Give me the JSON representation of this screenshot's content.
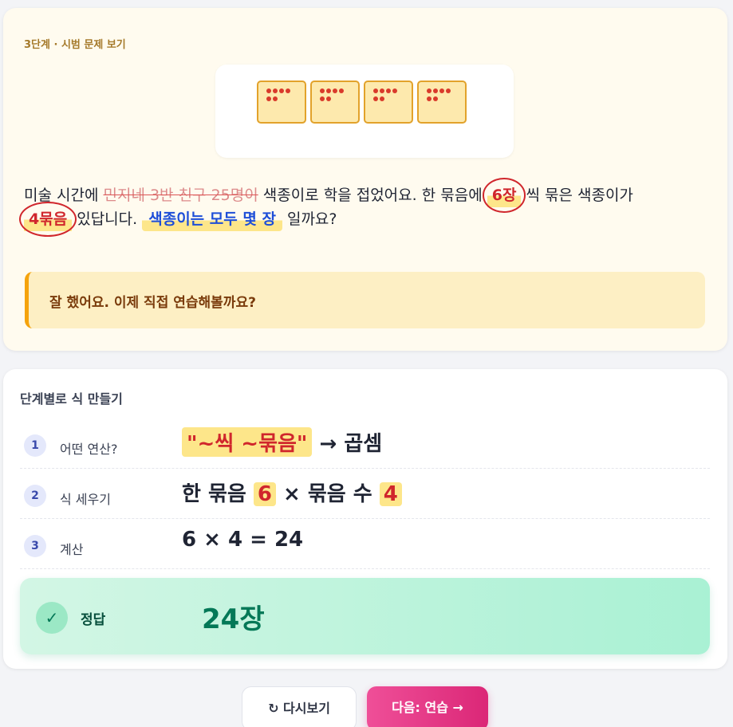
{
  "step_label": "3단계 · 시범 문제 보기",
  "illustration": {
    "paper_count": 4,
    "dots_per_paper": 6,
    "paper_color": "#fde9ad",
    "dot_color": "#d93a2b"
  },
  "problem": {
    "p1": "미술 시간에 ",
    "strike": "민지네 3반 친구 25명이",
    "p2": " 색종이로 학을 접었어요. 한 묶음에 ",
    "num1": "6장",
    "p3": " 씩 묶은 색종이가",
    "num2": "4묶음",
    "p4": " 있답니다. ",
    "question": "색종이는 모두 몇 장",
    "p5": " 일까요?"
  },
  "praise": "잘 했어요. 이제 직접 연습해볼까요?",
  "section_title": "단계별로 식 만들기",
  "steps": [
    {
      "num": "1",
      "name": "어떤 연산?",
      "quote": "\"~씩 ~묶음\"",
      "arrow": " → ",
      "result": "곱셈"
    },
    {
      "num": "2",
      "name": "식 세우기",
      "a": "한 묶음 ",
      "v1": "6",
      "b": " × 묶음 수 ",
      "v2": "4"
    },
    {
      "num": "3",
      "name": "계산",
      "expr": "6 × 4 = 24"
    }
  ],
  "answer": {
    "check": "✓",
    "label": "정답",
    "value": "24장"
  },
  "buttons": {
    "replay": "↻ 다시보기",
    "next": "다음: 연습 →"
  },
  "colors": {
    "accent_pink": "#db2777",
    "highlight_yellow": "#fde68a",
    "answer_green": "#047857"
  }
}
